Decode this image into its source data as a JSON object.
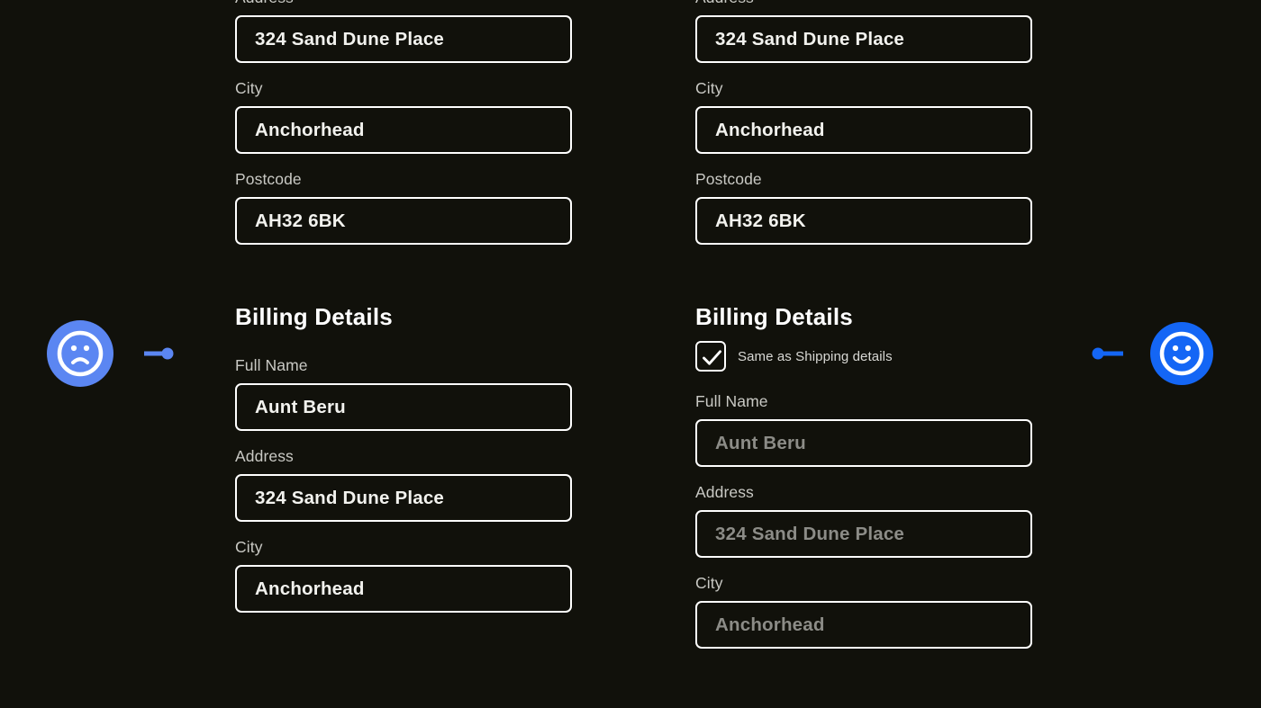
{
  "theme": {
    "background": "#11110b",
    "border": "#ffffff",
    "label_color": "#c9c9c4",
    "value_color": "#f2f2ee",
    "disabled_value_color": "#8c8c87",
    "sad_accent": "#5b86f2",
    "happy_accent": "#1466f5"
  },
  "left_column": {
    "shipping_fields": [
      {
        "label": "Address",
        "value": "324 Sand Dune Place",
        "muted": false
      },
      {
        "label": "City",
        "value": "Anchorhead",
        "muted": false
      },
      {
        "label": "Postcode",
        "value": "AH32 6BK",
        "muted": false
      }
    ],
    "billing_heading": "Billing Details",
    "billing_fields": [
      {
        "label": "Full Name",
        "value": "Aunt Beru",
        "muted": false
      },
      {
        "label": "Address",
        "value": "324 Sand Dune Place",
        "muted": false
      },
      {
        "label": "City",
        "value": "Anchorhead",
        "muted": false
      }
    ]
  },
  "right_column": {
    "shipping_fields": [
      {
        "label": "Address",
        "value": "324 Sand Dune Place",
        "muted": false
      },
      {
        "label": "City",
        "value": "Anchorhead",
        "muted": false
      },
      {
        "label": "Postcode",
        "value": "AH32 6BK",
        "muted": false
      }
    ],
    "billing_heading": "Billing Details",
    "same_as_shipping": {
      "label": "Same as Shipping details",
      "checked": true
    },
    "billing_fields": [
      {
        "label": "Full Name",
        "value": "Aunt Beru",
        "muted": true
      },
      {
        "label": "Address",
        "value": "324 Sand Dune Place",
        "muted": true
      },
      {
        "label": "City",
        "value": "Anchorhead",
        "muted": true
      }
    ]
  },
  "markers": {
    "left": {
      "icon": "frowning-face-icon",
      "sentiment": "negative",
      "color": "#5b86f2"
    },
    "right": {
      "icon": "smiling-face-icon",
      "sentiment": "positive",
      "color": "#1466f5"
    }
  }
}
